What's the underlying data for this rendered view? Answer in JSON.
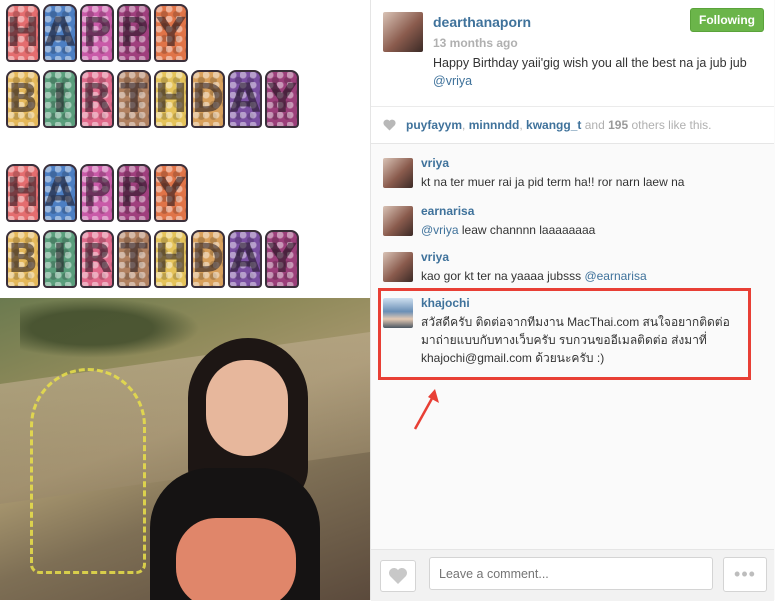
{
  "post_image": {
    "banner_top_row1": [
      "H",
      "A",
      "P",
      "P",
      "Y"
    ],
    "banner_top_row2": [
      "B",
      "I",
      "R",
      "T",
      "H",
      "D",
      "A",
      "Y"
    ]
  },
  "post": {
    "username": "dearthanaporn",
    "time_ago": "13 months ago",
    "caption_text": "Happy Birthday yaii'gig wish you all the best na ja jub jub",
    "caption_mention": "@vriya",
    "follow_label": "Following"
  },
  "likes": {
    "user1": "puyfayym",
    "user2": "minnndd",
    "user3": "kwangg_t",
    "and": "and",
    "count": "195",
    "suffix": "others like this."
  },
  "comments": [
    {
      "user": "vriya",
      "text": "kt na ter muer rai ja pid term ha!! ror narn laew na"
    },
    {
      "user": "earnarisa",
      "mention": "@vriya",
      "text": "leaw channnn laaaaaaaa"
    },
    {
      "user": "vriya",
      "text": "kao gor kt ter na yaaaa jubsss",
      "mention_after": "@earnarisa"
    },
    {
      "user": "khajochi",
      "text": "สวัสดีครับ ติดต่อจากทีมงาน MacThai.com สนใจอยากติดต่อมาถ่ายแบบกับทางเว็บครับ รบกวนขออีเมลติดต่อ ส่งมาที่ khajochi@gmail.com ด้วยนะครับ :)"
    }
  ],
  "footer": {
    "comment_placeholder": "Leave a comment...",
    "more_label": "•••"
  },
  "colors": {
    "link_blue": "#3f729b",
    "follow_green": "#6bb54a",
    "highlight_red": "#e83f35"
  }
}
